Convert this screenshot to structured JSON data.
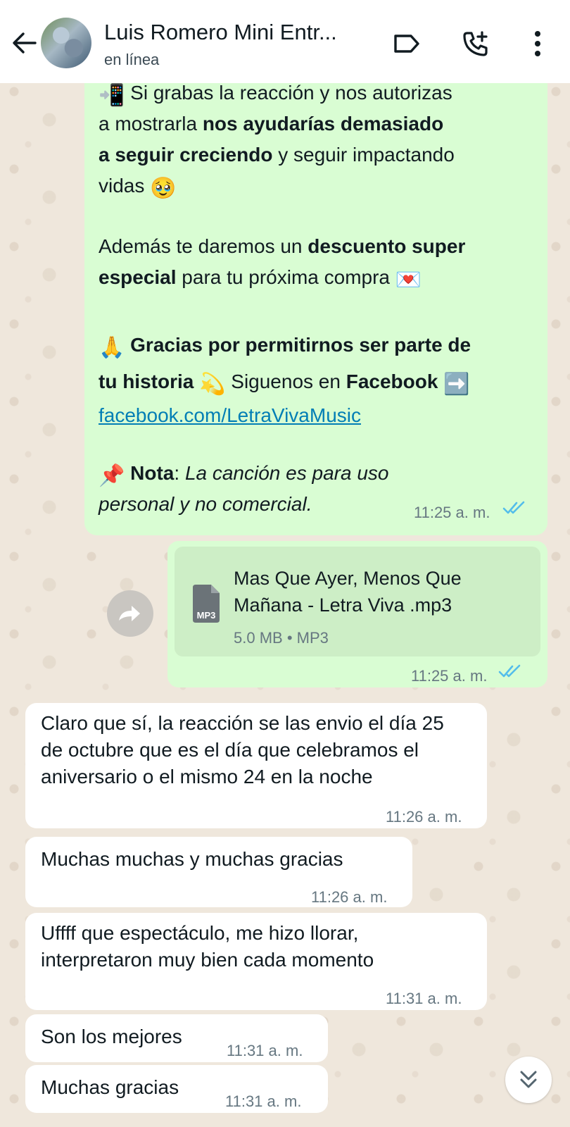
{
  "header": {
    "contact_name": "Luis Romero Mini Entr...",
    "status": "en línea"
  },
  "messages": {
    "big_message": {
      "line1_emoji": "📲",
      "line1": "Si grabas la reacción y nos autorizas",
      "line2_prefix": "a mostrarla ",
      "line2_bold": "nos ayudarías demasiado",
      "line3_bold": "a seguir creciendo",
      "line3_suffix": " y seguir impactando",
      "line4": "vidas ",
      "line4_emoji": "🥹",
      "line5_prefix": "Además te daremos un ",
      "line5_bold": "descuento super",
      "line6_bold": "especial",
      "line6_suffix": " para tu próxima compra ",
      "line6_emoji": "💌",
      "line7_emoji": "🙏",
      "line7_bold": "Gracias por permitirnos ser parte de",
      "line8_bold": "tu historia",
      "line8_emoji": "💫",
      "line8_mid": " Siguenos en ",
      "line8_bold2": "Facebook",
      "line8_emoji2": "➡️",
      "link": "facebook.com/LetraVivaMusic",
      "line10_emoji": "📌",
      "line10_bold": "Nota",
      "line10_colon": ": ",
      "line10_italic": "La canción es para uso",
      "line11_italic": "personal y no comercial.",
      "time": "11:25 a. m."
    },
    "file_message": {
      "file_type_badge": "MP3",
      "file_name": "Mas Que Ayer, Menos Que Mañana - Letra Viva .mp3",
      "file_size": "5.0 MB",
      "file_sep": " • ",
      "file_type": "MP3",
      "time": "11:25 a. m."
    },
    "incoming": [
      {
        "text": "Claro que sí, la reacción se las envio el día 25 de octubre que es el día que celebramos el aniversario o el mismo 24 en la noche",
        "time": "11:26 a. m."
      },
      {
        "text": "Muchas muchas y muchas gracias",
        "time": "11:26 a. m."
      },
      {
        "text": "Uffff que espectáculo, me hizo llorar, interpretaron muy bien cada momento",
        "time": "11:31 a. m."
      },
      {
        "text": "Son los mejores",
        "time": "11:31 a. m."
      },
      {
        "text": "Muchas gracias",
        "time": "11:31 a. m."
      }
    ]
  },
  "colors": {
    "outgoing_bubble": "#d9fdd3",
    "incoming_bubble": "#ffffff",
    "read_ticks": "#53bdeb",
    "link": "#027eb5"
  },
  "icons": {
    "back": "arrow-left-icon",
    "label": "label-tag-icon",
    "call": "add-call-icon",
    "menu": "more-vertical-icon",
    "forward": "forward-icon",
    "scroll": "double-chevron-down-icon"
  }
}
